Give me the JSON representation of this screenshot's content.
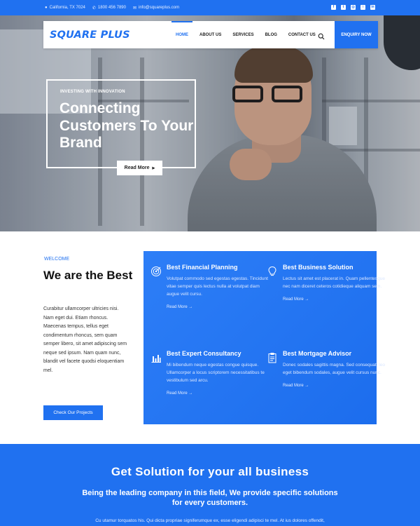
{
  "topbar": {
    "location": "California, TX 7024",
    "phone": "1800 456 7890",
    "email": "info@squareplus.com",
    "social_icons": [
      "facebook-icon",
      "twitter-icon",
      "globe-icon",
      "instagram-icon",
      "linkedin-icon"
    ]
  },
  "nav": {
    "logo": "SQUARE PLUS",
    "items": [
      "HOME",
      "ABOUT US",
      "SERVICES",
      "BLOG",
      "CONTACT US"
    ],
    "active": "HOME",
    "cta": "ENQUIRY NOW"
  },
  "hero": {
    "eyebrow": "INVESTING WITH INNOVATION",
    "title": "Connecting Customers To Your Brand",
    "button": "Read More"
  },
  "about": {
    "eyebrow": "WELCOME",
    "title": "We are the Best",
    "text": "Curabitur ullamcorper ultricies nisi. Nam eget dui. Etiam rhoncus. Maecenas tempus, tellus eget condimentum rhoncus, sem quam semper libero, sit amet adipiscing sem neque sed ipsum. Nam quam nunc, blandit vel facete quodsi eloquentiam mel.",
    "button": "Check Our Projects"
  },
  "services": [
    {
      "icon": "target-icon",
      "title": "Best Financial Planning",
      "desc": "Volutpat commodo sed egestas egestas. Tincidunt vitae semper quis lectus nulla at volutpat diam augue velit cursu.",
      "more": "Read More →"
    },
    {
      "icon": "lightbulb-icon",
      "title": "Best Business Solution",
      "desc": "Lectus sit amet est placerat in. Quam pellentesque nec nam diceret ceteros cotidieque aliquam sem.",
      "more": "Read More →"
    },
    {
      "icon": "bar-chart-icon",
      "title": "Best Expert Consultancy",
      "desc": "Mi bibendum neque egestas congue quisque. Ullamcorper a locus scriptorem necessitatibus te vestibulum sed arcu.",
      "more": "Read More →"
    },
    {
      "icon": "clipboard-icon",
      "title": "Best Mortgage Advisor",
      "desc": "Donec sodales sagittis magna. Sed consequat, leo eget bibendum sodales, augue velit cursus nunc.",
      "more": "Read More →"
    }
  ],
  "band": {
    "heading": "Get Solution for your all business",
    "subheading": "Being the leading company in this field, We provide specific solutions for every customers.",
    "text": "Cu utamur torquatos his. Qui dicta propriae signiferumque ex, esse eligendi adipisci te mel. At ius dolores offendit,"
  },
  "colors": {
    "brand": "#2071f0",
    "text": "#222222"
  }
}
